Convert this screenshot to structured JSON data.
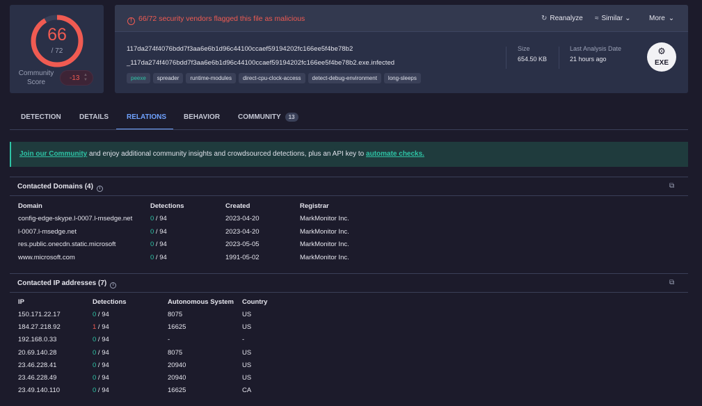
{
  "score": {
    "detections": "66",
    "total": "/ 72",
    "detection_fraction": 0.9167,
    "gauge_color": "#f05b52",
    "community_label": "Community\nScore",
    "community_value": "-13"
  },
  "header": {
    "alert": "66/72 security vendors flagged this file as malicious",
    "reanalyze_label": "Reanalyze",
    "similar_label": "Similar",
    "more_label": "More"
  },
  "file": {
    "hash": "117da274f4076bdd7f3aa6e6b1d96c44100ccaef59194202fc166ee5f4be78b2",
    "name": "_117da274f4076bdd7f3aa6e6b1d96c44100ccaef59194202fc166ee5f4be78b2.exe.infected",
    "tags": [
      "peexe",
      "spreader",
      "runtime-modules",
      "direct-cpu-clock-access",
      "detect-debug-environment",
      "long-sleeps"
    ],
    "size_label": "Size",
    "size_value": "654.50 KB",
    "last_analysis_label": "Last Analysis Date",
    "last_analysis_value": "21 hours ago",
    "type_badge": "EXE"
  },
  "tabs": [
    {
      "label": "DETECTION"
    },
    {
      "label": "DETAILS"
    },
    {
      "label": "RELATIONS",
      "active": true
    },
    {
      "label": "BEHAVIOR"
    },
    {
      "label": "COMMUNITY",
      "count": "13"
    }
  ],
  "banner": {
    "link1": "Join our Community",
    "middle": " and enjoy additional community insights and crowdsourced detections, plus an API key to ",
    "link2": "automate checks."
  },
  "domains": {
    "title": "Contacted Domains",
    "count": "(4)",
    "headers": [
      "Domain",
      "Detections",
      "Created",
      "Registrar"
    ],
    "rows": [
      {
        "domain": "config-edge-skype.l-0007.l-msedge.net",
        "det": "0",
        "det_total": " / 94",
        "created": "2023-04-20",
        "registrar": "MarkMonitor Inc."
      },
      {
        "domain": "l-0007.l-msedge.net",
        "det": "0",
        "det_total": " / 94",
        "created": "2023-04-20",
        "registrar": "MarkMonitor Inc."
      },
      {
        "domain": "res.public.onecdn.static.microsoft",
        "det": "0",
        "det_total": " / 94",
        "created": "2023-05-05",
        "registrar": "MarkMonitor Inc."
      },
      {
        "domain": "www.microsoft.com",
        "det": "0",
        "det_total": " / 94",
        "created": "1991-05-02",
        "registrar": "MarkMonitor Inc."
      }
    ]
  },
  "ips": {
    "title": "Contacted IP addresses",
    "count": "(7)",
    "headers": [
      "IP",
      "Detections",
      "Autonomous System",
      "Country"
    ],
    "rows": [
      {
        "ip": "150.171.22.17",
        "det": "0",
        "det_total": " / 94",
        "as": "8075",
        "country": "US"
      },
      {
        "ip": "184.27.218.92",
        "det": "1",
        "det_total": " / 94",
        "as": "16625",
        "country": "US"
      },
      {
        "ip": "192.168.0.33",
        "det": "0",
        "det_total": " / 94",
        "as": "-",
        "country": "-"
      },
      {
        "ip": "20.69.140.28",
        "det": "0",
        "det_total": " / 94",
        "as": "8075",
        "country": "US"
      },
      {
        "ip": "23.46.228.41",
        "det": "0",
        "det_total": " / 94",
        "as": "20940",
        "country": "US"
      },
      {
        "ip": "23.46.228.49",
        "det": "0",
        "det_total": " / 94",
        "as": "20940",
        "country": "US"
      },
      {
        "ip": "23.49.140.110",
        "det": "0",
        "det_total": " / 94",
        "as": "16625",
        "country": "CA"
      }
    ]
  }
}
